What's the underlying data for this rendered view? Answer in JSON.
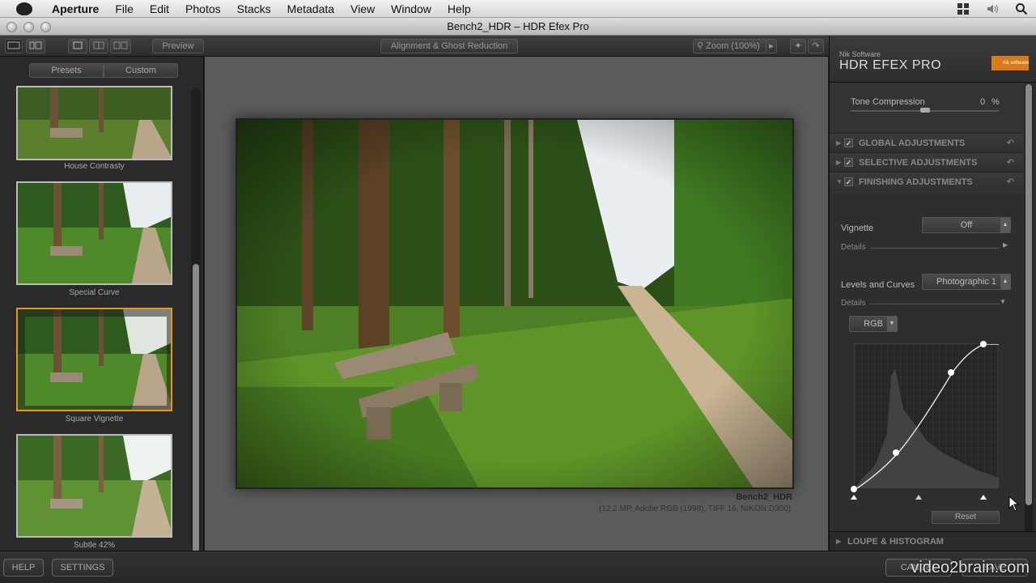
{
  "menubar": {
    "app": "Aperture",
    "items": [
      "File",
      "Edit",
      "Photos",
      "Stacks",
      "Metadata",
      "View",
      "Window",
      "Help"
    ]
  },
  "window": {
    "title": "Bench2_HDR – HDR Efex Pro"
  },
  "toolbar": {
    "preview": "Preview",
    "alignment": "Alignment & Ghost Reduction",
    "zoom": "Zoom (100%)"
  },
  "left": {
    "tab_presets": "Presets",
    "tab_custom": "Custom",
    "presets": [
      {
        "label": "House Contrasty",
        "selected": false
      },
      {
        "label": "Special Curve",
        "selected": false
      },
      {
        "label": "Square Vignette",
        "selected": true
      },
      {
        "label": "Subtle 42%",
        "selected": false
      }
    ]
  },
  "photo": {
    "name": "Bench2_HDR",
    "info": "(12.2 MP, Adobe RGB (1998), TIFF 16, NIKON D300)"
  },
  "right": {
    "brand_small": "Nik Software",
    "brand_big": "HDR EFEX PRO",
    "logo_text": "nik software",
    "tone_label": "Tone Compression",
    "tone_value": "0",
    "tone_unit": "%",
    "sections": [
      {
        "label": "GLOBAL ADJUSTMENTS",
        "checked": true,
        "expanded": false
      },
      {
        "label": "SELECTIVE ADJUSTMENTS",
        "checked": true,
        "expanded": false
      },
      {
        "label": "FINISHING ADJUSTMENTS",
        "checked": true,
        "expanded": true
      }
    ],
    "vignette_label": "Vignette",
    "vignette_value": "Off",
    "details_label": "Details",
    "levels_label": "Levels and Curves",
    "levels_value": "Photographic 1",
    "channel": "RGB",
    "reset": "Reset",
    "loupe": "LOUPE & HISTOGRAM"
  },
  "bottom": {
    "help": "HELP",
    "settings": "SETTINGS",
    "cancel": "CANCEL",
    "save": "SAVE"
  },
  "watermark": "video2brain.com",
  "colors": {
    "selected_border": "#e7981a",
    "logo": "#d97b1a"
  }
}
